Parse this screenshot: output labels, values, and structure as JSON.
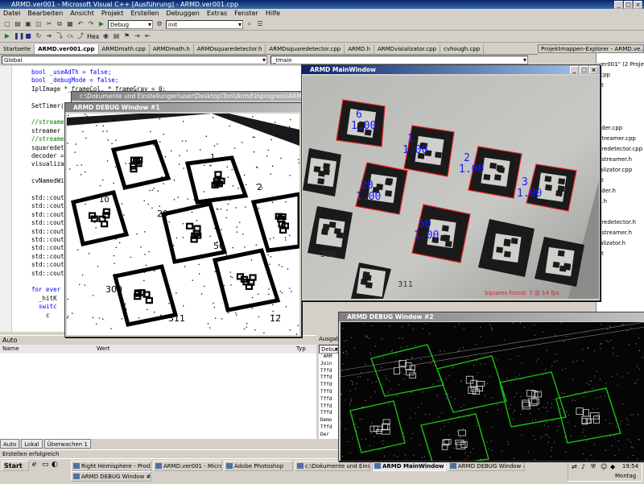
{
  "window": {
    "title": "ARMD.ver001 - Microsoft Visual C++ [Ausführung] - ARMD.ver001.cpp",
    "controls": [
      "_",
      "□",
      "×"
    ]
  },
  "menu": [
    "Datei",
    "Bearbeiten",
    "Ansicht",
    "Projekt",
    "Erstellen",
    "Debuggen",
    "Extras",
    "Fenster",
    "Hilfe"
  ],
  "toolbar": {
    "config_combo": "Debug",
    "function_combo": "init",
    "hex_label": "Hex"
  },
  "doc_tabs": [
    "Startseite",
    "ARMD.ver001.cpp",
    "ARMDmath.cpp",
    "ARMDmath.h",
    "ARMDsquaredetector.h",
    "ARMDsquaredetector.cpp",
    "ARMD.h",
    "ARMDvisializator.cpp",
    "cvhough.cpp"
  ],
  "scope": {
    "left": "Global",
    "right": "_tmain"
  },
  "code_lines": [
    {
      "t": "bool _useAdTh = false;",
      "c": "kw"
    },
    {
      "t": "bool _debugMode = false;",
      "c": "kw"
    },
    {
      "t": "IplImage *_frameCol, *_frameGray = 0;",
      "c": ""
    },
    {
      "t": "",
      "c": ""
    },
    {
      "t": "SetTimer(",
      "c": ""
    },
    {
      "t": "",
      "c": ""
    },
    {
      "t": "//streame",
      "c": "cm"
    },
    {
      "t": "streamer",
      "c": ""
    },
    {
      "t": "//streame",
      "c": "cm"
    },
    {
      "t": "squaredet",
      "c": ""
    },
    {
      "t": "decoder =",
      "c": ""
    },
    {
      "t": "visualiza",
      "c": ""
    },
    {
      "t": "",
      "c": ""
    },
    {
      "t": "cvNamedWi",
      "c": ""
    },
    {
      "t": "",
      "c": ""
    },
    {
      "t": "std::cout",
      "c": ""
    },
    {
      "t": "std::cout",
      "c": ""
    },
    {
      "t": "std::cout",
      "c": ""
    },
    {
      "t": "std::cout",
      "c": ""
    },
    {
      "t": "std::cout",
      "c": ""
    },
    {
      "t": "std::cout",
      "c": ""
    },
    {
      "t": "std::cout",
      "c": ""
    },
    {
      "t": "std::cout",
      "c": ""
    },
    {
      "t": "std::cout",
      "c": ""
    },
    {
      "t": "std::cout",
      "c": ""
    },
    {
      "t": "",
      "c": ""
    },
    {
      "t": "for ever",
      "c": "kw"
    },
    {
      "t": "  _hitK",
      "c": ""
    },
    {
      "t": "  switc",
      "c": "kw"
    },
    {
      "t": "    c",
      "c": ""
    }
  ],
  "solution_explorer": {
    "title": "Projektmappen-Explorer - ARMD.ve...",
    "items": [
      "ver001\" (2 Projekt",
      ".cpp",
      "xt",
      "oder.cpp",
      "dtreamer.cpp",
      "aredetector.cpp",
      "ostreamer.h",
      "ializator.cpp",
      "xt",
      "oder.h",
      "h.h",
      "h",
      "aredetector.h",
      "ostreamer.h",
      "ializator.h",
      "xt"
    ]
  },
  "auto_panel": {
    "title": "Auto",
    "columns": [
      "Name",
      "Wert",
      "Typ"
    ],
    "tabs": [
      "Auto",
      "Lokal",
      "Überwachen 1"
    ]
  },
  "output_panel": {
    "title": "Ausgab",
    "combo": "Debug",
    "lines": [
      "'ARM",
      "Join",
      "Tffd",
      "Tffd",
      "Tffd",
      "Tffd",
      "Tffd",
      "Tffd",
      "Tffd",
      "Demo",
      "Tffd",
      "Der"
    ]
  },
  "status": "Erstellen erfolgreich",
  "cmd_window": {
    "title": "c:\\Dokumente und Einstellungen\\user\\Desktop\\Toni\\Armd\\inprogress\\ARM"
  },
  "debug1": {
    "title": "ARMD DEBUG Window #1",
    "labels": [
      "6",
      "10",
      "1",
      "20",
      "2",
      "50",
      "300",
      "311",
      "12"
    ]
  },
  "main_window": {
    "title": "ARMD MainWindow",
    "detections": [
      {
        "id": "6",
        "score": "1.00"
      },
      {
        "id": "1",
        "score": "1.00"
      },
      {
        "id": "2",
        "score": "1.00"
      },
      {
        "id": "3",
        "score": "1.00"
      },
      {
        "id": "20",
        "score": "1.00"
      },
      {
        "id": "50",
        "score": "1.00"
      }
    ],
    "paper_labels": [
      "300",
      "311"
    ],
    "status_text": "Squares found: 7 @ 14 fps"
  },
  "debug2": {
    "title": "ARMD DEBUG Window #2"
  },
  "taskbar": {
    "start": "Start",
    "tasks": [
      "Right Hemisphere - Prod...",
      "ARMD.ver001 - Microsof...",
      "Adobe Photoshop",
      "c:\\Dokumente und Einste...",
      "ARMD MainWindow",
      "ARMD DEBUG Window #1",
      "ARMD DEBUG Window #2"
    ],
    "clock": "19:54",
    "day": "Montag"
  },
  "colors": {
    "title_active": "#0a246a",
    "detect_red": "#e02020",
    "detect_blue": "#1a1aff",
    "edge_green": "#18c018"
  }
}
